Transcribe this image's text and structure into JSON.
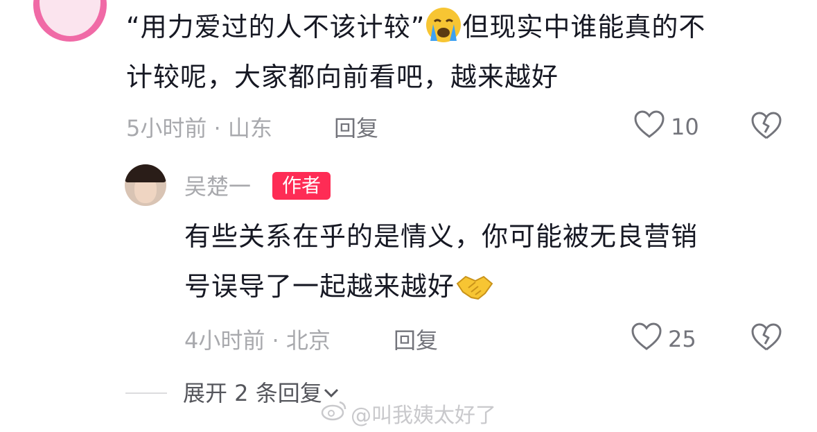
{
  "comment1": {
    "text_before_emoji": "“用力爱过的人不该计较”",
    "emoji": "loudly-crying-face",
    "text_after_emoji": "但现实中谁能真的不",
    "line2": "计较呢，大家都向前看吧，越来越好",
    "meta": "5小时前 · 山东",
    "reply_label": "回复",
    "like_count": "10"
  },
  "comment2": {
    "username": "吴楚一",
    "badge": "作者",
    "line1": "有些关系在乎的是情义，你可能被无良营销",
    "line2": "号误导了一起越来越好",
    "emoji": "handshake",
    "meta": "4小时前 · 北京",
    "reply_label": "回复",
    "like_count": "25"
  },
  "expand": {
    "label": "展开 2 条回复"
  },
  "watermark": {
    "text": "@叫我姨太好了"
  },
  "colors": {
    "badge": "#fe2c55",
    "meta": "#a8a9ad",
    "text": "#161823"
  }
}
